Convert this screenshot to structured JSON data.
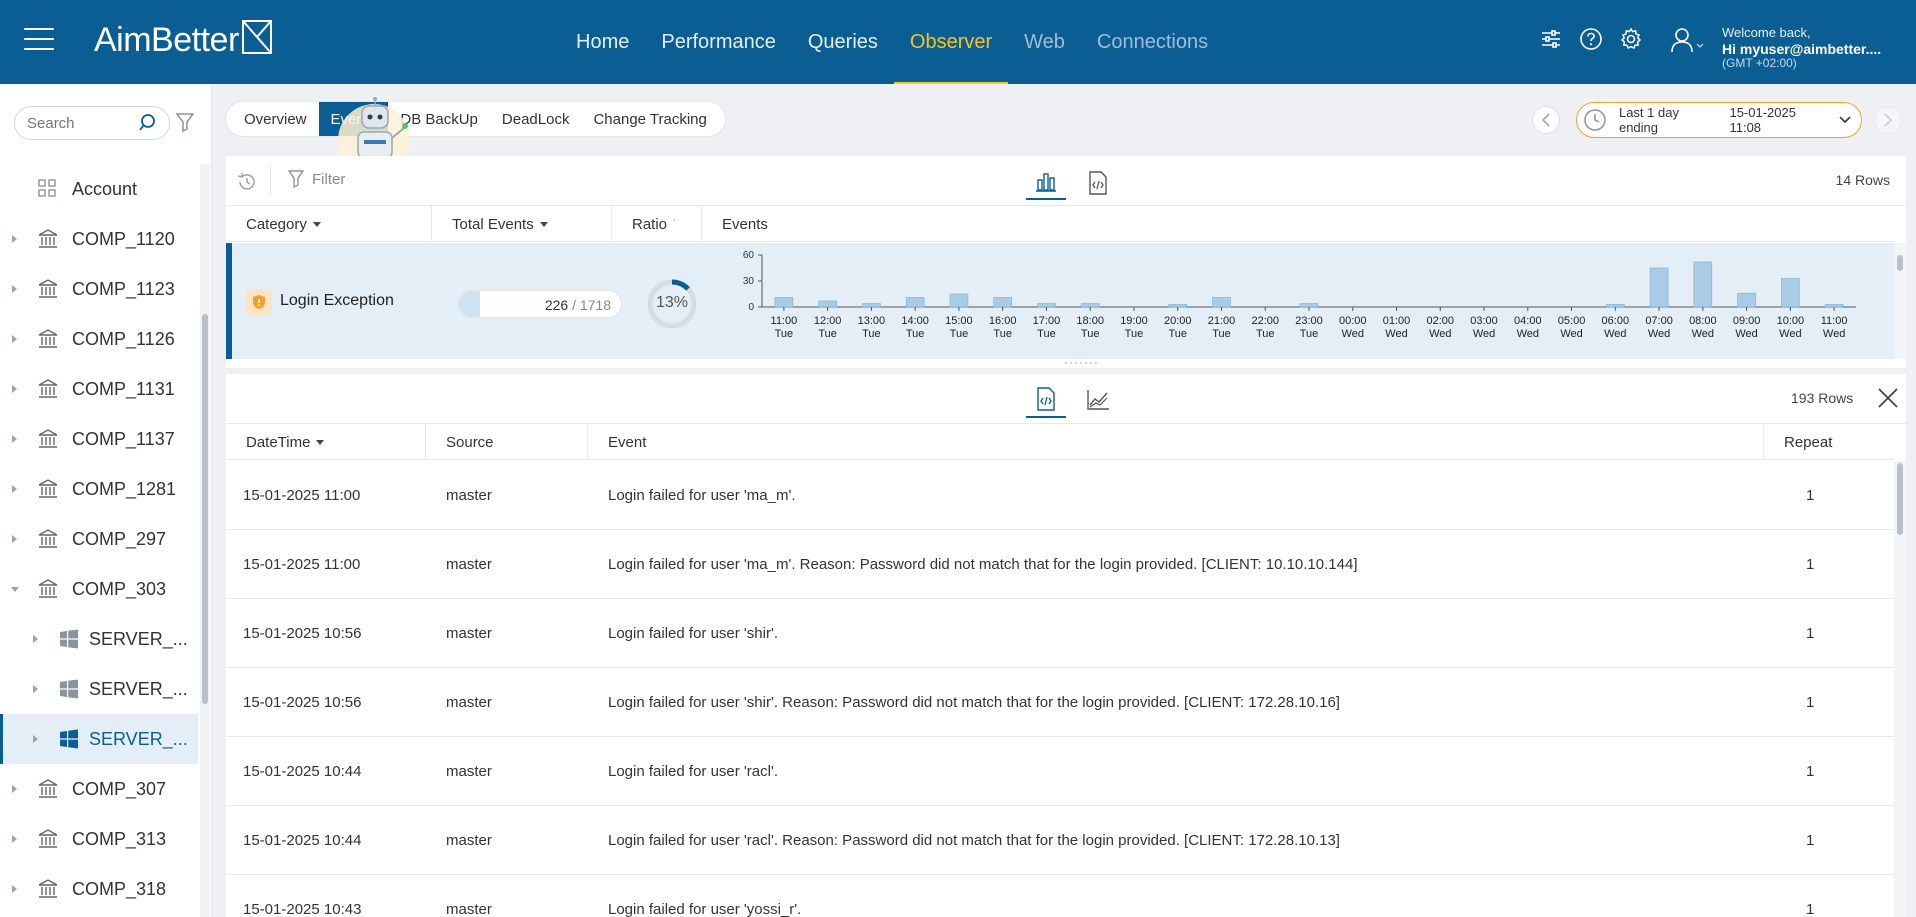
{
  "app": {
    "logo_text": "AimBetter",
    "nav": [
      {
        "label": "Home",
        "state": "normal"
      },
      {
        "label": "Performance",
        "state": "normal"
      },
      {
        "label": "Queries",
        "state": "normal"
      },
      {
        "label": "Observer",
        "state": "active"
      },
      {
        "label": "Web",
        "state": "dim"
      },
      {
        "label": "Connections",
        "state": "dim"
      }
    ],
    "user": {
      "welcome": "Welcome back,",
      "name": "Hi myuser@aimbetter....",
      "timezone": "(GMT +02:00)"
    },
    "icons": [
      "sliders-icon",
      "help-icon",
      "settings-icon",
      "user-icon"
    ]
  },
  "colors": {
    "header_bg": "#0a5e94",
    "accent_active": "#f5c518",
    "selection_bg": "#e4eef6",
    "bar_color": "#a9cbe4",
    "time_range_border": "#f0a030"
  },
  "sidebar": {
    "search_placeholder": "Search",
    "items": [
      {
        "label": "Account",
        "icon": "grid-icon",
        "caret": "none",
        "level": 0
      },
      {
        "label": "COMP_1120",
        "icon": "building-icon",
        "caret": "right",
        "level": 0
      },
      {
        "label": "COMP_1123",
        "icon": "building-icon",
        "caret": "right",
        "level": 0
      },
      {
        "label": "COMP_1126",
        "icon": "building-icon",
        "caret": "right",
        "level": 0
      },
      {
        "label": "COMP_1131",
        "icon": "building-icon",
        "caret": "right",
        "level": 0
      },
      {
        "label": "COMP_1137",
        "icon": "building-icon",
        "caret": "right",
        "level": 0
      },
      {
        "label": "COMP_1281",
        "icon": "building-icon",
        "caret": "right",
        "level": 0
      },
      {
        "label": "COMP_297",
        "icon": "building-icon",
        "caret": "right",
        "level": 0
      },
      {
        "label": "COMP_303",
        "icon": "building-icon",
        "caret": "down",
        "level": 0
      },
      {
        "label": "SERVER_...",
        "icon": "windows-icon",
        "caret": "right",
        "level": 1
      },
      {
        "label": "SERVER_...",
        "icon": "windows-icon",
        "caret": "right",
        "level": 1
      },
      {
        "label": "SERVER_...",
        "icon": "windows-icon",
        "caret": "right",
        "level": 1,
        "selected": true
      },
      {
        "label": "COMP_307",
        "icon": "building-icon",
        "caret": "right",
        "level": 0
      },
      {
        "label": "COMP_313",
        "icon": "building-icon",
        "caret": "right",
        "level": 0
      },
      {
        "label": "COMP_318",
        "icon": "building-icon",
        "caret": "right",
        "level": 0
      }
    ]
  },
  "subtabs": [
    {
      "label": "Overview",
      "active": false
    },
    {
      "label": "Events",
      "active": true
    },
    {
      "label": "DB BackUp",
      "active": false
    },
    {
      "label": "DeadLock",
      "active": false
    },
    {
      "label": "Change Tracking",
      "active": false
    }
  ],
  "time_range": {
    "label": "Last 1 day ending",
    "date": "15-01-2025 11:08"
  },
  "top_panel": {
    "filter_placeholder": "Filter",
    "rows_count": "14 Rows",
    "columns": [
      "Category",
      "Total Events",
      "Ratio",
      "Events"
    ],
    "row": {
      "category": "Login Exception",
      "total": "226",
      "total_sep": "/",
      "total_all": "1718",
      "total_fraction": 0.1315,
      "ratio_text": "13%",
      "ratio_value": 0.13
    }
  },
  "chart_data": {
    "type": "bar",
    "y_ticks": [
      "60",
      "30",
      "0"
    ],
    "ylim": [
      0,
      60
    ],
    "categories": [
      [
        "11:00",
        "Tue"
      ],
      [
        "12:00",
        "Tue"
      ],
      [
        "13:00",
        "Tue"
      ],
      [
        "14:00",
        "Tue"
      ],
      [
        "15:00",
        "Tue"
      ],
      [
        "16:00",
        "Tue"
      ],
      [
        "17:00",
        "Tue"
      ],
      [
        "18:00",
        "Tue"
      ],
      [
        "19:00",
        "Tue"
      ],
      [
        "20:00",
        "Tue"
      ],
      [
        "21:00",
        "Tue"
      ],
      [
        "22:00",
        "Tue"
      ],
      [
        "23:00",
        "Tue"
      ],
      [
        "00:00",
        "Wed"
      ],
      [
        "01:00",
        "Wed"
      ],
      [
        "02:00",
        "Wed"
      ],
      [
        "03:00",
        "Wed"
      ],
      [
        "04:00",
        "Wed"
      ],
      [
        "05:00",
        "Wed"
      ],
      [
        "06:00",
        "Wed"
      ],
      [
        "07:00",
        "Wed"
      ],
      [
        "08:00",
        "Wed"
      ],
      [
        "09:00",
        "Wed"
      ],
      [
        "10:00",
        "Wed"
      ],
      [
        "11:00",
        "Wed"
      ]
    ],
    "values": [
      11,
      7,
      4,
      11,
      15,
      11,
      4,
      4,
      0,
      3,
      11,
      0,
      4,
      0,
      0,
      0,
      0,
      0,
      0,
      3,
      45,
      52,
      16,
      33,
      3
    ]
  },
  "bottom_panel": {
    "rows_count": "193 Rows",
    "columns": [
      "DateTime",
      "Source",
      "Event",
      "Repeat"
    ],
    "rows": [
      {
        "datetime": "15-01-2025 11:00",
        "source": "master",
        "event": "Login failed for user 'ma_m'.",
        "repeat": "1"
      },
      {
        "datetime": "15-01-2025 11:00",
        "source": "master",
        "event": "Login failed for user 'ma_m'. Reason: Password did not match that for the login provided. [CLIENT: 10.10.10.144]",
        "repeat": "1"
      },
      {
        "datetime": "15-01-2025 10:56",
        "source": "master",
        "event": "Login failed for user 'shir'.",
        "repeat": "1"
      },
      {
        "datetime": "15-01-2025 10:56",
        "source": "master",
        "event": "Login failed for user 'shir'. Reason: Password did not match that for the login provided. [CLIENT: 172.28.10.16]",
        "repeat": "1"
      },
      {
        "datetime": "15-01-2025 10:44",
        "source": "master",
        "event": "Login failed for user 'racl'.",
        "repeat": "1"
      },
      {
        "datetime": "15-01-2025 10:44",
        "source": "master",
        "event": "Login failed for user 'racl'. Reason: Password did not match that for the login provided. [CLIENT: 172.28.10.13]",
        "repeat": "1"
      },
      {
        "datetime": "15-01-2025 10:43",
        "source": "master",
        "event": "Login failed for user 'yossi_r'.",
        "repeat": "1"
      }
    ]
  }
}
